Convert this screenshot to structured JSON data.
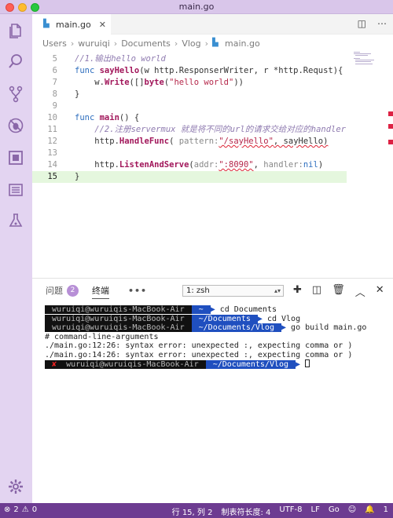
{
  "window": {
    "title": "main.go"
  },
  "tab": {
    "filename": "main.go"
  },
  "breadcrumb": [
    "Users",
    "wuruiqi",
    "Documents",
    "Vlog",
    "main.go"
  ],
  "editor": {
    "lines": [
      {
        "num": "5",
        "tokens": [
          {
            "t": "//1.输出hello world",
            "c": "cm"
          }
        ]
      },
      {
        "num": "6",
        "tokens": [
          {
            "t": "func ",
            "c": "kw"
          },
          {
            "t": "sayHello",
            "c": "fn"
          },
          {
            "t": "(w http.ResponserWriter, r *http.Requst){",
            "c": "plain"
          }
        ]
      },
      {
        "num": "7",
        "tokens": [
          {
            "t": "    w.",
            "c": "plain"
          },
          {
            "t": "Write",
            "c": "fn"
          },
          {
            "t": "([]",
            "c": "plain"
          },
          {
            "t": "byte",
            "c": "fn"
          },
          {
            "t": "(",
            "c": "plain"
          },
          {
            "t": "\"hello world\"",
            "c": "str"
          },
          {
            "t": "))",
            "c": "plain"
          }
        ]
      },
      {
        "num": "8",
        "tokens": [
          {
            "t": "}",
            "c": "plain"
          }
        ]
      },
      {
        "num": "9",
        "tokens": []
      },
      {
        "num": "10",
        "tokens": [
          {
            "t": "func ",
            "c": "kw"
          },
          {
            "t": "main",
            "c": "fn"
          },
          {
            "t": "() {",
            "c": "plain"
          }
        ]
      },
      {
        "num": "11",
        "tokens": [
          {
            "t": "    //2.注册servermux 就是将不同的url的请求交给对应的handler",
            "c": "cm"
          }
        ]
      },
      {
        "num": "12",
        "tokens": [
          {
            "t": "    http.",
            "c": "plain"
          },
          {
            "t": "HandleFunc",
            "c": "fn"
          },
          {
            "t": "( ",
            "c": "plain"
          },
          {
            "t": "pattern:",
            "c": "lbl"
          },
          {
            "t": "\"/sayHello\"",
            "c": "str squiggle"
          },
          {
            "t": ", sayHello)",
            "c": "plain squiggle"
          }
        ]
      },
      {
        "num": "13",
        "tokens": []
      },
      {
        "num": "14",
        "tokens": [
          {
            "t": "    http.",
            "c": "plain"
          },
          {
            "t": "ListenAndServe",
            "c": "fn"
          },
          {
            "t": "(",
            "c": "plain"
          },
          {
            "t": "addr:",
            "c": "lbl"
          },
          {
            "t": "\":8090\"",
            "c": "str squiggle"
          },
          {
            "t": ", ",
            "c": "plain"
          },
          {
            "t": "handler:",
            "c": "lbl"
          },
          {
            "t": "nil",
            "c": "kw"
          },
          {
            "t": ")",
            "c": "plain"
          }
        ]
      },
      {
        "num": "15",
        "tokens": [
          {
            "t": "}",
            "c": "plain"
          }
        ]
      }
    ],
    "current_line": "15"
  },
  "panel": {
    "tab_problems": "问题",
    "problems_count": "2",
    "tab_terminal": "终端",
    "more": "•••",
    "terminal_select": "1: zsh",
    "terminal_lines": [
      {
        "user": " wuruiqi@wuruiqis-MacBook-Air ",
        "dir": " ~ ",
        "cmd": " cd Documents"
      },
      {
        "user": " wuruiqi@wuruiqis-MacBook-Air ",
        "dir": " ~/Documents ",
        "cmd": " cd Vlog"
      },
      {
        "user": " wuruiqi@wuruiqis-MacBook-Air ",
        "dir": " ~/Documents/Vlog ",
        "cmd": " go build main.go"
      },
      {
        "text": "# command-line-arguments"
      },
      {
        "text": "./main.go:12:26: syntax error: unexpected :, expecting comma or )"
      },
      {
        "text": "./main.go:14:26: syntax error: unexpected :, expecting comma or )"
      },
      {
        "err": " ✘ ",
        "user": "wuruiqi@wuruiqis-MacBook-Air ",
        "dir": " ~/Documents/Vlog ",
        "cursor": true
      }
    ]
  },
  "statusbar": {
    "errors": "2",
    "warnings": "0",
    "position": "行 15, 列 2",
    "tab_size": "制表符长度: 4",
    "encoding": "UTF-8",
    "eol": "LF",
    "language": "Go",
    "notifications": "1"
  },
  "colors": {
    "titlebar": "#d9c6ea",
    "activity": "#e3d4f1",
    "statusbar": "#6d3c91",
    "accent": "#1f4fbf"
  }
}
